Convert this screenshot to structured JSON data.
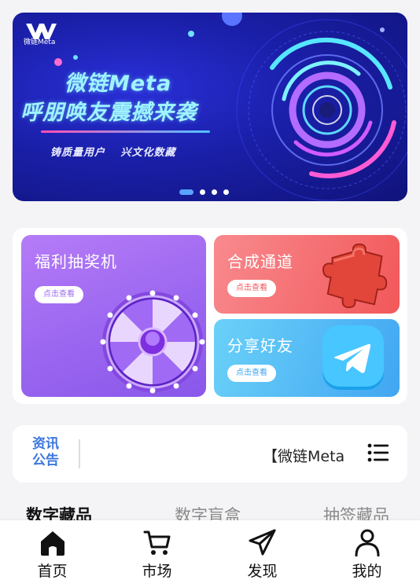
{
  "banner": {
    "logo_text": "微链Meta",
    "headline_line1": "微链Meta",
    "headline_line2": "呼朋唤友震撼来袭",
    "tagline": "铸质量用户 兴文化数藏",
    "slide_count": 4,
    "active_slide": 1
  },
  "feature": {
    "lottery": {
      "title": "福利抽奖机",
      "button": "点击查看"
    },
    "synthesis": {
      "title": "合成通道",
      "button": "点击查看"
    },
    "share": {
      "title": "分享好友",
      "button": "点击查看"
    }
  },
  "news": {
    "label": "资讯公告",
    "text": "【微链Meta"
  },
  "tabs": [
    {
      "label": "数字藏品",
      "active": true
    },
    {
      "label": "数字盲盒",
      "active": false
    },
    {
      "label": "抽签藏品",
      "active": false
    }
  ],
  "nav": {
    "items": [
      {
        "label": "首页",
        "icon": "home-icon",
        "active": true
      },
      {
        "label": "市场",
        "icon": "cart-icon",
        "active": false
      },
      {
        "label": "发现",
        "icon": "paper-plane-icon",
        "active": false
      },
      {
        "label": "我的",
        "icon": "user-icon",
        "active": false
      }
    ]
  },
  "colors": {
    "page_bg": "#f4f4f6",
    "banner_blue": "#1a1fa8",
    "lottery_purple": "#9b66f0",
    "synth_red": "#f2585a",
    "share_blue": "#41a6f2",
    "news_label_blue": "#3c77dd"
  }
}
